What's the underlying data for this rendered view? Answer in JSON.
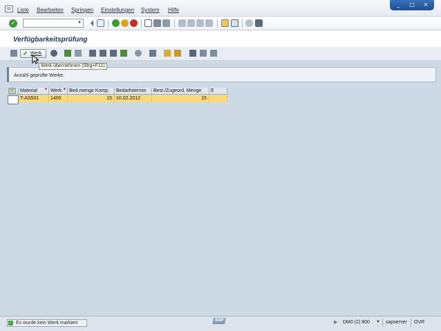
{
  "menu": {
    "items": [
      "Liste",
      "Bearbeiten",
      "Springen",
      "Einstellungen",
      "System",
      "Hilfe"
    ]
  },
  "window": {
    "controls": [
      "_",
      "□",
      "×"
    ]
  },
  "title": "Verfügbarkeitsprüfung",
  "app_toolbar": {
    "werk_button_label": "Werk",
    "tooltip": "Werk übernehmen   (Strg+F11)"
  },
  "info": {
    "label": "Anzahl geprüfte Werke:"
  },
  "table": {
    "columns": [
      {
        "label": "Material",
        "required": true
      },
      {
        "label": "Werk",
        "required": true
      },
      {
        "label": "Bed.menge Komp."
      },
      {
        "label": "Bedarfstermin"
      },
      {
        "label": "Best./Zugeord. Menge"
      },
      {
        "label": "E"
      }
    ],
    "rows": [
      {
        "material": "T-AS501",
        "werk": "1400",
        "bedmenge": "15",
        "bedarfstermin": "10.02.2012",
        "bestmenge": "15",
        "e": ""
      }
    ]
  },
  "status": {
    "message": "Es wurde kein Werk markiert",
    "sap_logo": "SAP",
    "system": "DM0 (2) 800",
    "server": "sapserver",
    "mode": "OVR"
  },
  "colors": {
    "row_highlight": "#fbd97a",
    "main_background": "#cdd9e5",
    "title_color": "#1f3550"
  }
}
